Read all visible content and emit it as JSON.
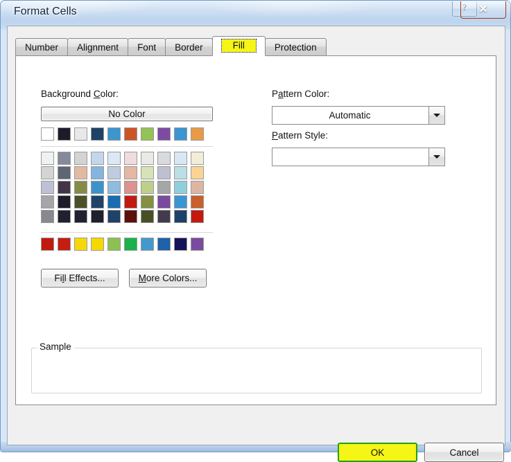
{
  "window": {
    "title": "Format Cells",
    "help_button_glyph": "?",
    "close_button_glyph": "✕"
  },
  "tabs": [
    {
      "label": "Number",
      "active": false
    },
    {
      "label": "Alignment",
      "active": false
    },
    {
      "label": "Font",
      "active": false
    },
    {
      "label": "Border",
      "active": false
    },
    {
      "label": "Fill",
      "active": true
    },
    {
      "label": "Protection",
      "active": false
    }
  ],
  "fill_tab": {
    "background_color_label_pre": "Background ",
    "background_color_label_key": "C",
    "background_color_label_post": "olor:",
    "no_color_button": "No Color",
    "pattern_color_label_pre": "P",
    "pattern_color_label_key": "a",
    "pattern_color_label_post": "ttern Color:",
    "pattern_color_value": "Automatic",
    "pattern_style_label_pre": "",
    "pattern_style_label_key": "P",
    "pattern_style_label_post": "attern Style:",
    "pattern_style_value": "",
    "fill_effects_pre": "Fi",
    "fill_effects_key": "l",
    "fill_effects_post": "l Effects...",
    "more_colors_pre": "",
    "more_colors_key": "M",
    "more_colors_post": "ore Colors...",
    "sample_legend": "Sample"
  },
  "palette": {
    "theme_colors": [
      "#ffffff",
      "#1c1c2b",
      "#e8e8e8",
      "#1f4e6b",
      "#3d96cd",
      "#cc5528",
      "#97c košice",
      "#7e4ba3",
      "#3a95d0",
      "#e89a48"
    ],
    "theme_colors_fixed": [
      "#ffffff",
      "#1c1c2b",
      "#e8e8e8",
      "#1f4268",
      "#3d96cd",
      "#cc5528",
      "#95c254",
      "#7e4ba3",
      "#3a95d0",
      "#e89a48"
    ],
    "theme_shades": [
      [
        "#f0f2f1",
        "#85899a",
        "#d2d3d2",
        "#c3d7ec",
        "#dbe8f6",
        "#f0dbdf",
        "#e9eae6",
        "#d8dbdc",
        "#d9e7f5",
        "#f2edd8"
      ],
      [
        "#d4d5d3",
        "#5e6573",
        "#e3b9a2",
        "#84b4e0",
        "#bfccdf",
        "#e3b7a1",
        "#d6e3b6",
        "#bec0d2",
        "#bbdfe6",
        "#fbd392"
      ],
      [
        "#bec1d3",
        "#413547",
        "#848c47",
        "#3b93cb",
        "#8fbde0",
        "#dc9391",
        "#bdcf8b",
        "#a5a6a8",
        "#8ecfdd",
        "#ddb6a3"
      ],
      [
        "#a4a6a8",
        "#1d1c2a",
        "#4a5029",
        "#1f4268",
        "#1a6cb4",
        "#c31a10",
        "#849044",
        "#7a4a9f",
        "#3a95d0",
        "#c95f2c"
      ],
      [
        "#87898f",
        "#20202e",
        "#212033",
        "#1f1f2e",
        "#1f4268",
        "#5e100b",
        "#484f25",
        "#443a4d",
        "#1d4168",
        "#c5190e"
      ]
    ],
    "standard_colors": [
      "#c21a10",
      "#c51d12",
      "#f7d70a",
      "#f5d800",
      "#8cc152",
      "#1ab24b",
      "#4399ce",
      "#1d62aa",
      "#14145a",
      "#7a4b9e"
    ]
  },
  "footer": {
    "ok_label": "OK",
    "cancel_label": "Cancel"
  }
}
